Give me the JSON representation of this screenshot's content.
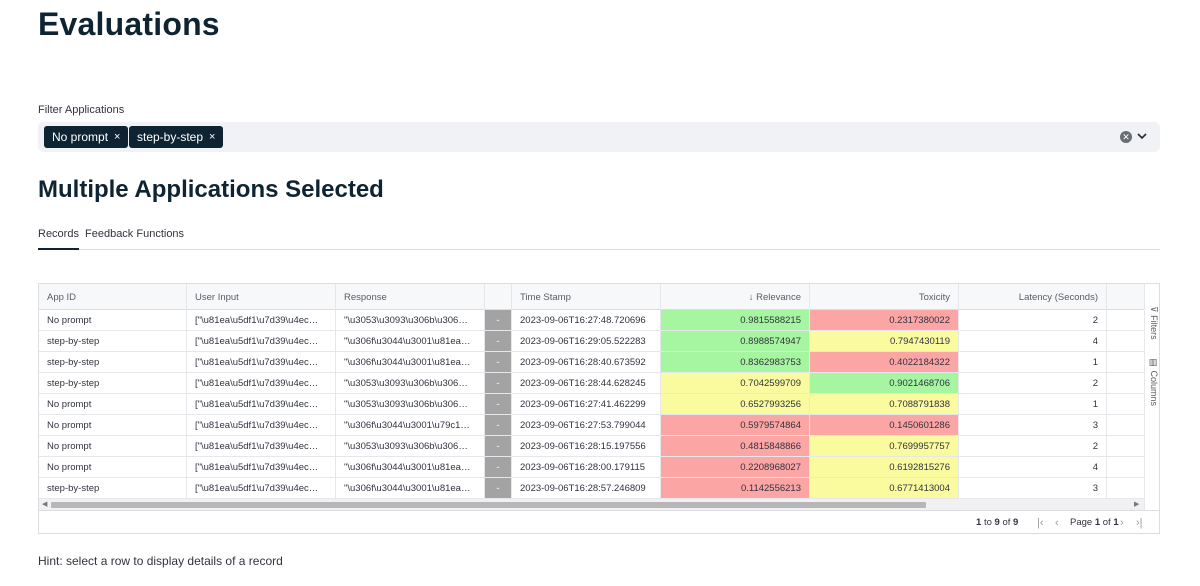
{
  "page": {
    "title": "Evaluations",
    "filter_label": "Filter Applications",
    "chips": [
      "No prompt",
      "step-by-step"
    ],
    "chip_close": "×",
    "section_title": "Multiple Applications Selected",
    "tabs": [
      "Records",
      "Feedback Functions"
    ],
    "hint": "Hint: select a row to display details of a record"
  },
  "grid": {
    "columns": [
      "App ID",
      "User Input",
      "Response",
      "",
      "Time Stamp",
      "Relevance",
      "Toxicity",
      "Latency (Seconds)"
    ],
    "sort_icon": "↓",
    "side_tabs": [
      "Filters",
      "Columns"
    ],
    "rows": [
      {
        "app": "No prompt",
        "input": "[\"\\u81ea\\u5df1\\u7d39\\u4ec…",
        "response": "\"\\u3053\\u3093\\u306b\\u306…",
        "dash": "-",
        "ts": "2023-09-06T16:27:48.720696",
        "rel": "0.9815588215",
        "rel_color": "green",
        "tox": "0.2317380022",
        "tox_color": "red",
        "lat": "2"
      },
      {
        "app": "step-by-step",
        "input": "[\"\\u81ea\\u5df1\\u7d39\\u4ec…",
        "response": "\"\\u306f\\u3044\\u3001\\u81ea…",
        "dash": "-",
        "ts": "2023-09-06T16:29:05.522283",
        "rel": "0.8988574947",
        "rel_color": "green",
        "tox": "0.7947430119",
        "tox_color": "yellow",
        "lat": "4"
      },
      {
        "app": "step-by-step",
        "input": "[\"\\u81ea\\u5df1\\u7d39\\u4ec…",
        "response": "\"\\u306f\\u3044\\u3001\\u81ea…",
        "dash": "-",
        "ts": "2023-09-06T16:28:40.673592",
        "rel": "0.8362983753",
        "rel_color": "green",
        "tox": "0.4022184322",
        "tox_color": "red",
        "lat": "1"
      },
      {
        "app": "step-by-step",
        "input": "[\"\\u81ea\\u5df1\\u7d39\\u4ec…",
        "response": "\"\\u3053\\u3093\\u306b\\u306…",
        "dash": "-",
        "ts": "2023-09-06T16:28:44.628245",
        "rel": "0.7042599709",
        "rel_color": "yellow",
        "tox": "0.9021468706",
        "tox_color": "green",
        "lat": "2"
      },
      {
        "app": "No prompt",
        "input": "[\"\\u81ea\\u5df1\\u7d39\\u4ec…",
        "response": "\"\\u3053\\u3093\\u306b\\u306…",
        "dash": "-",
        "ts": "2023-09-06T16:27:41.462299",
        "rel": "0.6527993256",
        "rel_color": "yellow",
        "tox": "0.7088791838",
        "tox_color": "yellow",
        "lat": "1"
      },
      {
        "app": "No prompt",
        "input": "[\"\\u81ea\\u5df1\\u7d39\\u4ec…",
        "response": "\"\\u306f\\u3044\\u3001\\u79c1…",
        "dash": "-",
        "ts": "2023-09-06T16:27:53.799044",
        "rel": "0.5979574864",
        "rel_color": "red",
        "tox": "0.1450601286",
        "tox_color": "red",
        "lat": "3"
      },
      {
        "app": "No prompt",
        "input": "[\"\\u81ea\\u5df1\\u7d39\\u4ec…",
        "response": "\"\\u3053\\u3093\\u306b\\u306…",
        "dash": "-",
        "ts": "2023-09-06T16:28:15.197556",
        "rel": "0.4815848866",
        "rel_color": "red",
        "tox": "0.7699957757",
        "tox_color": "yellow",
        "lat": "2"
      },
      {
        "app": "No prompt",
        "input": "[\"\\u81ea\\u5df1\\u7d39\\u4ec…",
        "response": "\"\\u306f\\u3044\\u3001\\u81ea…",
        "dash": "-",
        "ts": "2023-09-06T16:28:00.179115",
        "rel": "0.2208968027",
        "rel_color": "red",
        "tox": "0.6192815276",
        "tox_color": "yellow",
        "lat": "4"
      },
      {
        "app": "step-by-step",
        "input": "[\"\\u81ea\\u5df1\\u7d39\\u4ec…",
        "response": "\"\\u306f\\u3044\\u3001\\u81ea…",
        "dash": "-",
        "ts": "2023-09-06T16:28:57.246809",
        "rel": "0.1142556213",
        "rel_color": "red",
        "tox": "0.6771413004",
        "tox_color": "yellow",
        "lat": "3"
      }
    ]
  },
  "pager": {
    "range_start": "1",
    "range_to": "to",
    "range_end": "9",
    "range_of": "of",
    "total": "9",
    "page_word": "Page",
    "page_num": "1",
    "page_of": "of",
    "page_total": "1"
  },
  "colors": {
    "green": "#a6f5a0",
    "yellow": "#fafa9f",
    "red": "#fba5a5",
    "chip_bg": "#0e2433"
  }
}
